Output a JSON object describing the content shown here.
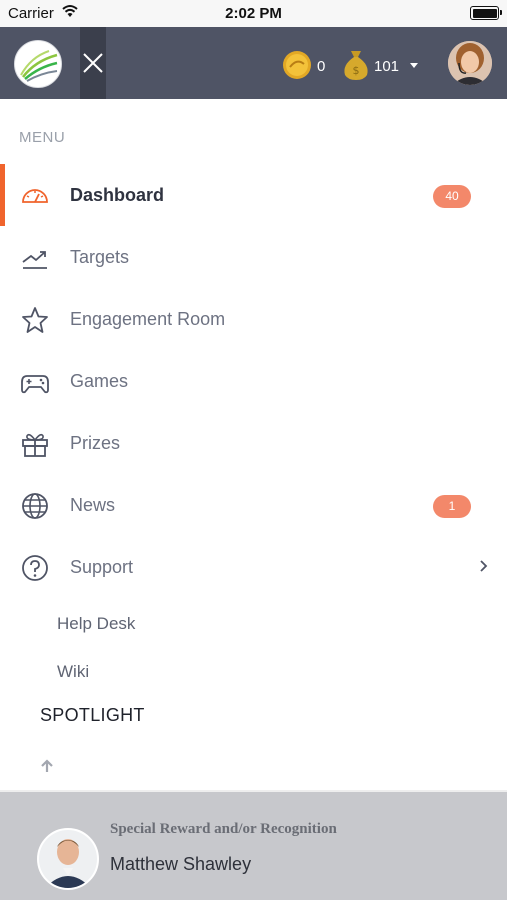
{
  "status_bar": {
    "carrier": "Carrier",
    "time": "2:02 PM"
  },
  "header": {
    "coins": "0",
    "bag": "101",
    "colors": {
      "bar": "#4f5465",
      "accent": "#f0642d",
      "badge": "#f3886a"
    }
  },
  "menu": {
    "heading": "MENU",
    "items": [
      {
        "label": "Dashboard",
        "icon": "speedometer-icon",
        "badge": "40",
        "active": true
      },
      {
        "label": "Targets",
        "icon": "trend-chart-icon"
      },
      {
        "label": "Engagement Room",
        "icon": "star-icon"
      },
      {
        "label": "Games",
        "icon": "gamepad-icon"
      },
      {
        "label": "Prizes",
        "icon": "gift-icon"
      },
      {
        "label": "News",
        "icon": "globe-icon",
        "badge": "1"
      },
      {
        "label": "Support",
        "icon": "help-circle-icon",
        "expandable": true
      }
    ],
    "sub_items": [
      "Help Desk",
      "Wiki"
    ]
  },
  "spotlight": {
    "heading": "SPOTLIGHT",
    "card_title": "Special Reward and/or Recognition",
    "name": "Matthew Shawley"
  }
}
